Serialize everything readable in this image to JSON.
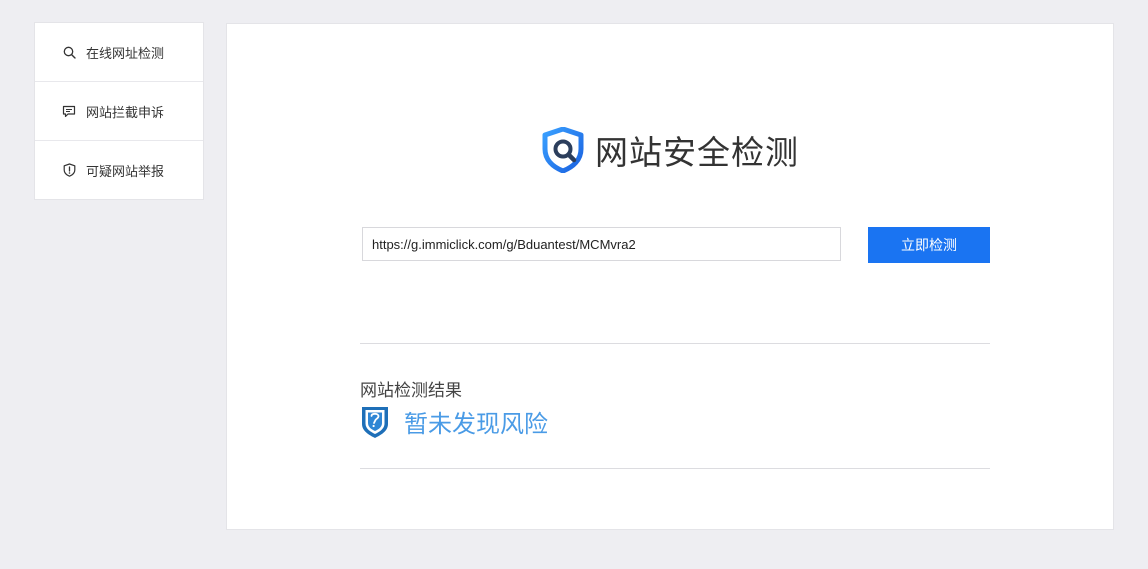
{
  "sidebar": {
    "items": [
      {
        "label": "在线网址检测",
        "icon": "search-icon"
      },
      {
        "label": "网站拦截申诉",
        "icon": "message-icon"
      },
      {
        "label": "可疑网站举报",
        "icon": "shield-alert-icon"
      }
    ]
  },
  "main": {
    "title": "网站安全检测",
    "logo_icon": "shield-search-icon",
    "url_input": {
      "value": "https://g.immiclick.com/g/Bduantest/MCMvra2",
      "placeholder": ""
    },
    "check_button_label": "立即检测",
    "result": {
      "heading": "网站检测结果",
      "status": "暂未发现风险",
      "status_icon": "safe-shield-icon",
      "status_color": "#4a9be6"
    }
  },
  "colors": {
    "accent": "#1a74f2",
    "background": "#eeeef2",
    "panel": "#ffffff"
  }
}
